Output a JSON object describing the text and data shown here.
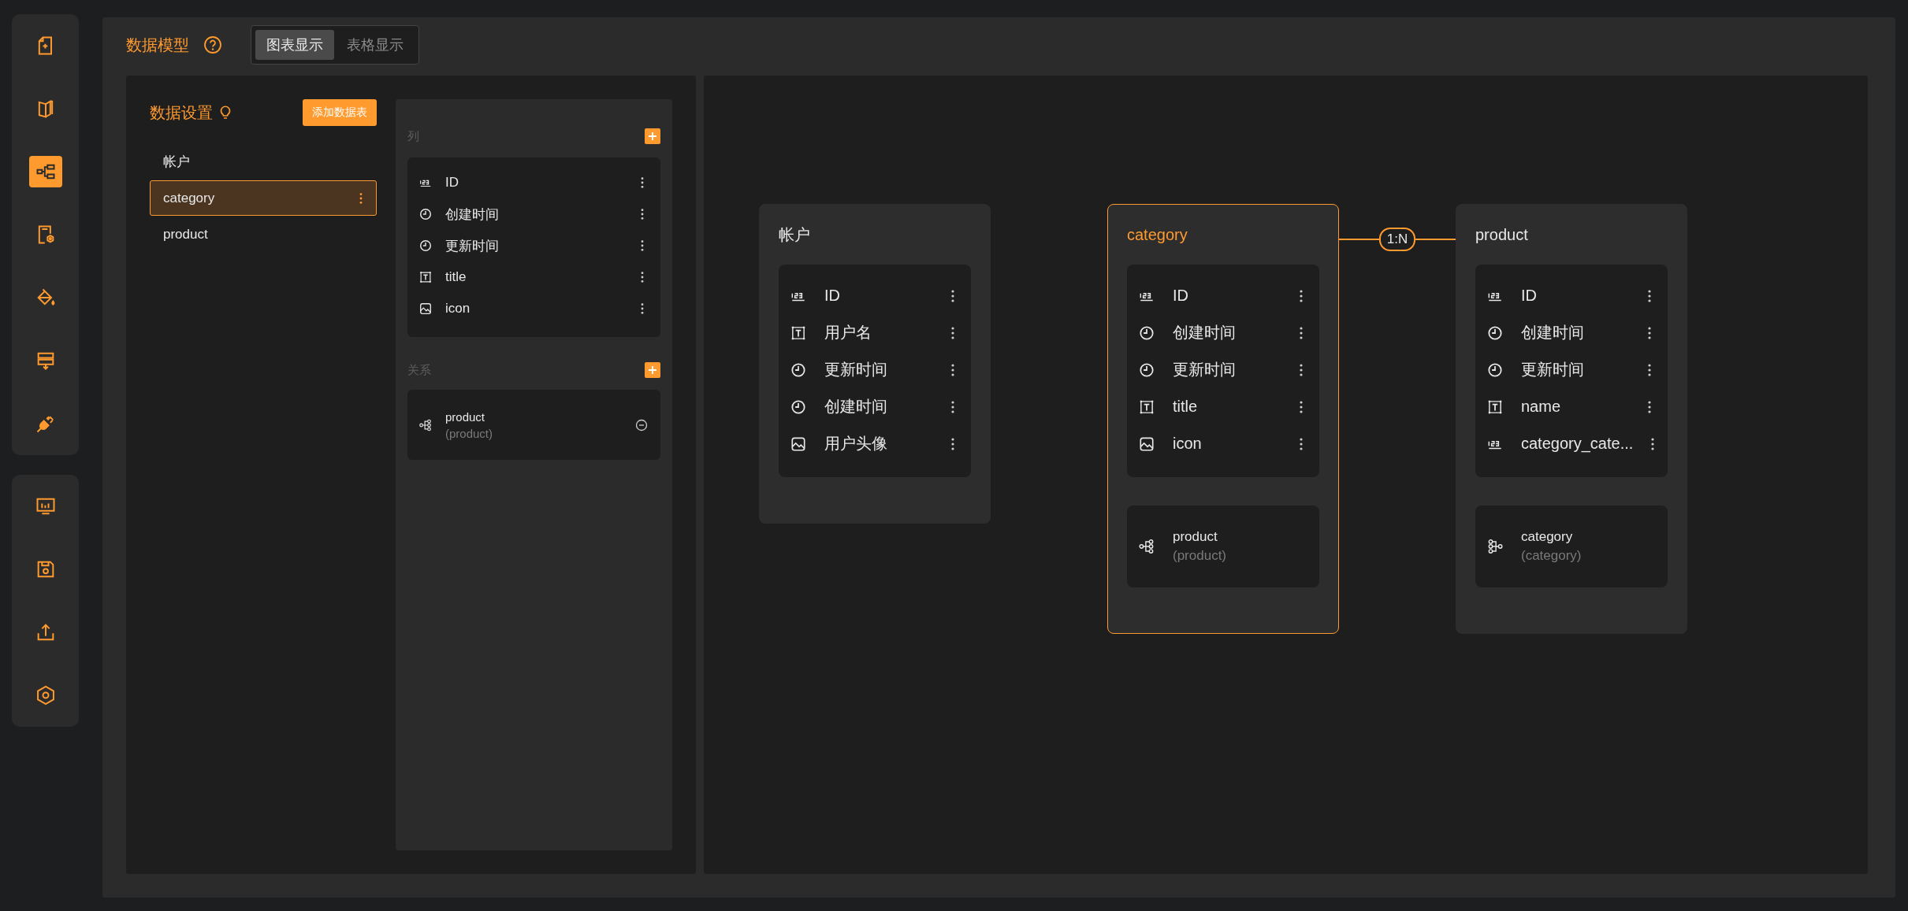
{
  "sidebar": {
    "groups": [
      {
        "items": [
          {
            "kind": "file-plus",
            "selected": false
          },
          {
            "kind": "book",
            "selected": false
          },
          {
            "kind": "tree",
            "selected": true
          },
          {
            "kind": "doc-gear",
            "selected": false
          },
          {
            "kind": "paint-bucket",
            "selected": false
          },
          {
            "kind": "layers",
            "selected": false
          },
          {
            "kind": "plug",
            "selected": false
          }
        ]
      },
      {
        "items": [
          {
            "kind": "chart-board",
            "selected": false
          },
          {
            "kind": "save",
            "selected": false
          },
          {
            "kind": "upload",
            "selected": false
          },
          {
            "kind": "hexagon",
            "selected": false
          }
        ]
      }
    ]
  },
  "header": {
    "title": "数据模型",
    "view_tabs": [
      {
        "label": "图表显示",
        "selected": true
      },
      {
        "label": "表格显示",
        "selected": false
      }
    ]
  },
  "settings": {
    "title": "数据设置",
    "add_button": "添加数据表",
    "tables": [
      {
        "name": "帐户",
        "selected": false
      },
      {
        "name": "category",
        "selected": true
      },
      {
        "name": "product",
        "selected": false
      }
    ],
    "columns_label": "列",
    "columns": [
      {
        "kind": "number",
        "name": "ID"
      },
      {
        "kind": "datetime",
        "name": "创建时间"
      },
      {
        "kind": "datetime",
        "name": "更新时间"
      },
      {
        "kind": "text",
        "name": "title"
      },
      {
        "kind": "image",
        "name": "icon"
      }
    ],
    "relations_label": "关系",
    "relations": [
      {
        "kind": "one_to_many",
        "name": "product",
        "target": "(product)"
      }
    ]
  },
  "diagram": {
    "entities": [
      {
        "name": "帐户",
        "selected": false,
        "columns": [
          {
            "kind": "number",
            "name": "ID"
          },
          {
            "kind": "text",
            "name": "用户名"
          },
          {
            "kind": "datetime",
            "name": "更新时间"
          },
          {
            "kind": "datetime",
            "name": "创建时间"
          },
          {
            "kind": "image",
            "name": "用户头像"
          }
        ]
      },
      {
        "name": "category",
        "selected": true,
        "link_label": "1:N",
        "columns": [
          {
            "kind": "number",
            "name": "ID"
          },
          {
            "kind": "datetime",
            "name": "创建时间"
          },
          {
            "kind": "datetime",
            "name": "更新时间"
          },
          {
            "kind": "text",
            "name": "title"
          },
          {
            "kind": "image",
            "name": "icon"
          }
        ],
        "relations": [
          {
            "kind": "one_to_many",
            "name": "product",
            "target": "(product)"
          }
        ]
      },
      {
        "name": "product",
        "selected": false,
        "columns": [
          {
            "kind": "number",
            "name": "ID"
          },
          {
            "kind": "datetime",
            "name": "创建时间"
          },
          {
            "kind": "datetime",
            "name": "更新时间"
          },
          {
            "kind": "text",
            "name": "name"
          },
          {
            "kind": "number",
            "name": "category_cate..."
          }
        ],
        "relations": [
          {
            "kind": "many_to_one",
            "name": "category",
            "target": "(category)"
          }
        ]
      }
    ]
  }
}
